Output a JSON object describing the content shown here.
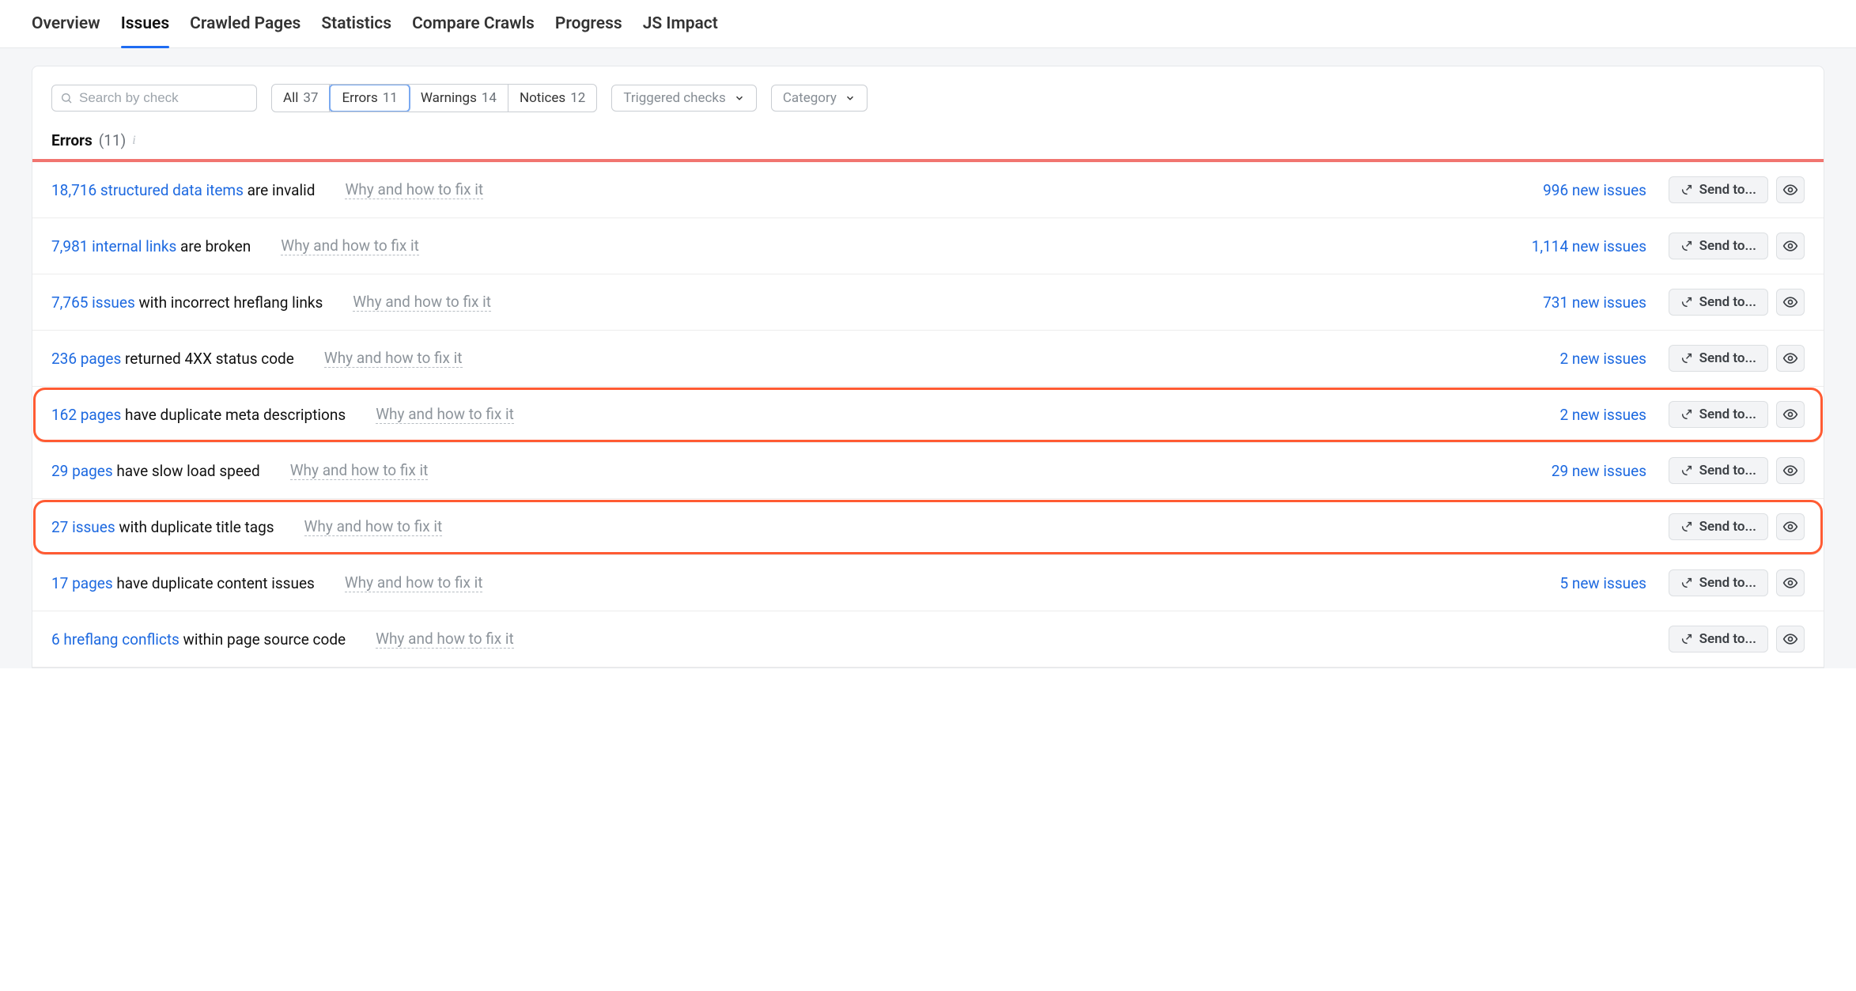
{
  "tabs": {
    "items": [
      {
        "label": "Overview",
        "active": false
      },
      {
        "label": "Issues",
        "active": true
      },
      {
        "label": "Crawled Pages",
        "active": false
      },
      {
        "label": "Statistics",
        "active": false
      },
      {
        "label": "Compare Crawls",
        "active": false
      },
      {
        "label": "Progress",
        "active": false
      },
      {
        "label": "JS Impact",
        "active": false
      }
    ]
  },
  "controls": {
    "search_placeholder": "Search by check",
    "segments": [
      {
        "label": "All",
        "count": "37",
        "active": false
      },
      {
        "label": "Errors",
        "count": "11",
        "active": true
      },
      {
        "label": "Warnings",
        "count": "14",
        "active": false
      },
      {
        "label": "Notices",
        "count": "12",
        "active": false
      }
    ],
    "triggered_dd": "Triggered checks",
    "category_dd": "Category"
  },
  "section": {
    "title": "Errors",
    "count": "(11)"
  },
  "why_label": "Why and how to fix it",
  "send_to_label": "Send to...",
  "rows": [
    {
      "link_text": "18,716 structured data items",
      "rest": " are invalid",
      "new_issues": "996 new issues",
      "highlighted": false
    },
    {
      "link_text": "7,981 internal links",
      "rest": " are broken",
      "new_issues": "1,114 new issues",
      "highlighted": false
    },
    {
      "link_text": "7,765 issues",
      "rest": " with incorrect hreflang links",
      "new_issues": "731 new issues",
      "highlighted": false
    },
    {
      "link_text": "236 pages",
      "rest": " returned 4XX status code",
      "new_issues": "2 new issues",
      "highlighted": false
    },
    {
      "link_text": "162 pages",
      "rest": " have duplicate meta descriptions",
      "new_issues": "2 new issues",
      "highlighted": true
    },
    {
      "link_text": "29 pages",
      "rest": " have slow load speed",
      "new_issues": "29 new issues",
      "highlighted": false
    },
    {
      "link_text": "27 issues",
      "rest": " with duplicate title tags",
      "new_issues": "",
      "highlighted": true
    },
    {
      "link_text": "17 pages",
      "rest": " have duplicate content issues",
      "new_issues": "5 new issues",
      "highlighted": false
    },
    {
      "link_text": "6 hreflang conflicts",
      "rest": " within page source code",
      "new_issues": "",
      "highlighted": false
    }
  ]
}
